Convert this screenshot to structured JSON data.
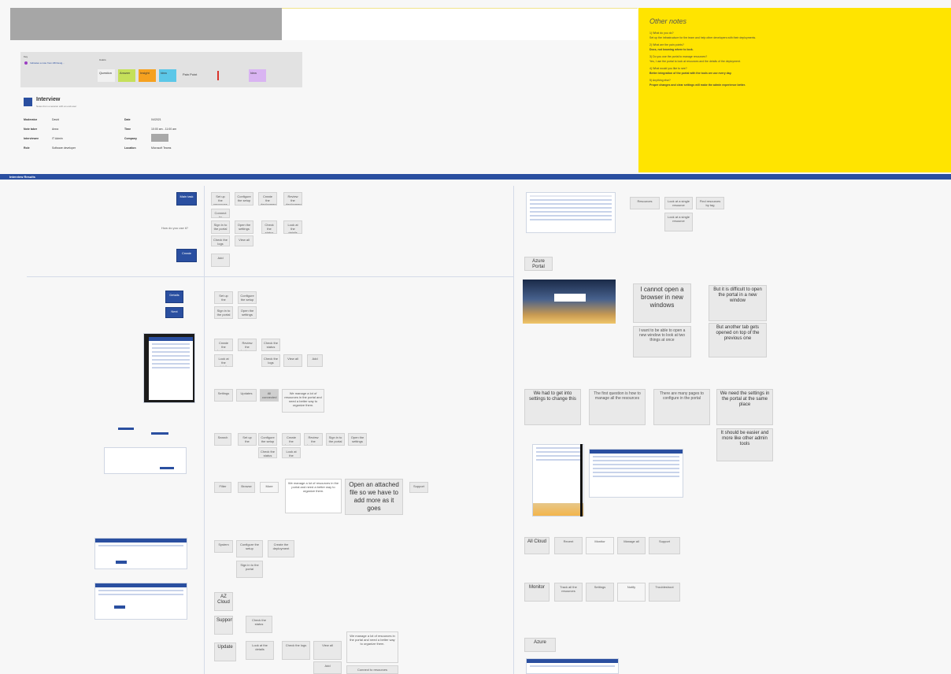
{
  "top": {
    "legend_small_label": "Key",
    "legend_item": "Indicates a note from AB Desig...",
    "legend_colors_label": "Colors",
    "legend_chips": [
      "Question",
      "Answer",
      "Insight",
      "Idea",
      "Pain Point",
      "Idea"
    ],
    "interview_title": "Interview",
    "interview_subtitle": "Notes from a session with an end-user",
    "fields_left": [
      {
        "k": "Moderator",
        "v": "David"
      },
      {
        "k": "Note taker",
        "v": "Anna"
      },
      {
        "k": "Interviewee",
        "v": "IT Admin"
      },
      {
        "k": "Role",
        "v": "Software developer"
      }
    ],
    "fields_right": [
      {
        "k": "Date",
        "v": "04/2021"
      },
      {
        "k": "Time",
        "v": "10:00 am - 11:00 am"
      },
      {
        "k": "Company",
        "v": ""
      },
      {
        "k": "Location",
        "v": "Microsoft Teams"
      }
    ]
  },
  "other_notes": {
    "title": "Other notes",
    "lines": [
      "1) What do you do?",
      "Set up the infrastructure for the team and help other developers with their deployments.",
      "2) What are the pain points?",
      "Docs, not knowing where to look.",
      "3) Do you use the portal to manage resources?",
      "Yes, I use the portal to look at resources and the details of the deployment.",
      "4) What would you like to see?",
      "Better integration of the portal with the tools we use every day.",
      "5) Anything else?",
      "Proper changes and clear settings will make the admin experience better."
    ]
  },
  "band_title": "Interview Results",
  "left": {
    "btn_primary_1": "Main task",
    "btn_primary_2": "Create",
    "btn_primary_3": "Details",
    "btn_primary_4": "Next",
    "side_label": "How do you use it?",
    "row1": [
      "Set up the resources",
      "Configure the setup",
      "Create the deployment",
      "Review the deployment"
    ],
    "row2": [
      "Connect to resources"
    ],
    "row3": [
      "Sign in to the portal",
      "Open the settings",
      "Check the status",
      "Look at the details"
    ],
    "row4": [
      "Check the logs",
      "View all"
    ],
    "row5": [
      "Add"
    ],
    "big_note": "Open an attached file so we have to add more as it goes",
    "long_note": "We manage a lot of resources in the portal and need a better way to organize them.",
    "block_notes": [
      "Search",
      "Filter",
      "Browse",
      "More"
    ],
    "label_a": "Settings",
    "label_b": "Updates",
    "label_c": "All connected",
    "label_d": "Support",
    "label_e": "System",
    "label_f": "Update"
  },
  "right": {
    "top_notes": [
      "Resources",
      "Look at a single resource",
      "Find resources by tag"
    ],
    "section1": "Azure Portal",
    "big_text_1": "I cannot open a browser in new windows",
    "med_text_1": "I want to be able to open a new window to look at two things at once",
    "big_text_2": "But it is difficult to open the portal in a new window",
    "med_text_2": "But another tab gets opened on top of the previous one",
    "row_big": [
      "We had to get into settings to change this",
      "The first question is how to manage all the resources",
      "There are many pages to configure in the portal",
      "We need the settings in the portal at the same place"
    ],
    "big_text_3": "It should be easier and more like other admin tools",
    "section2": "AZ Cloud",
    "row_a": [
      "All Cloud",
      "Recent",
      "Monitor",
      "Manage all",
      "Support"
    ],
    "section3": "Monitor",
    "row_b": [
      "Monitor",
      "Track all the resources",
      "Settings",
      "Notify",
      "Troubleshoot"
    ],
    "section4": "Azure"
  }
}
